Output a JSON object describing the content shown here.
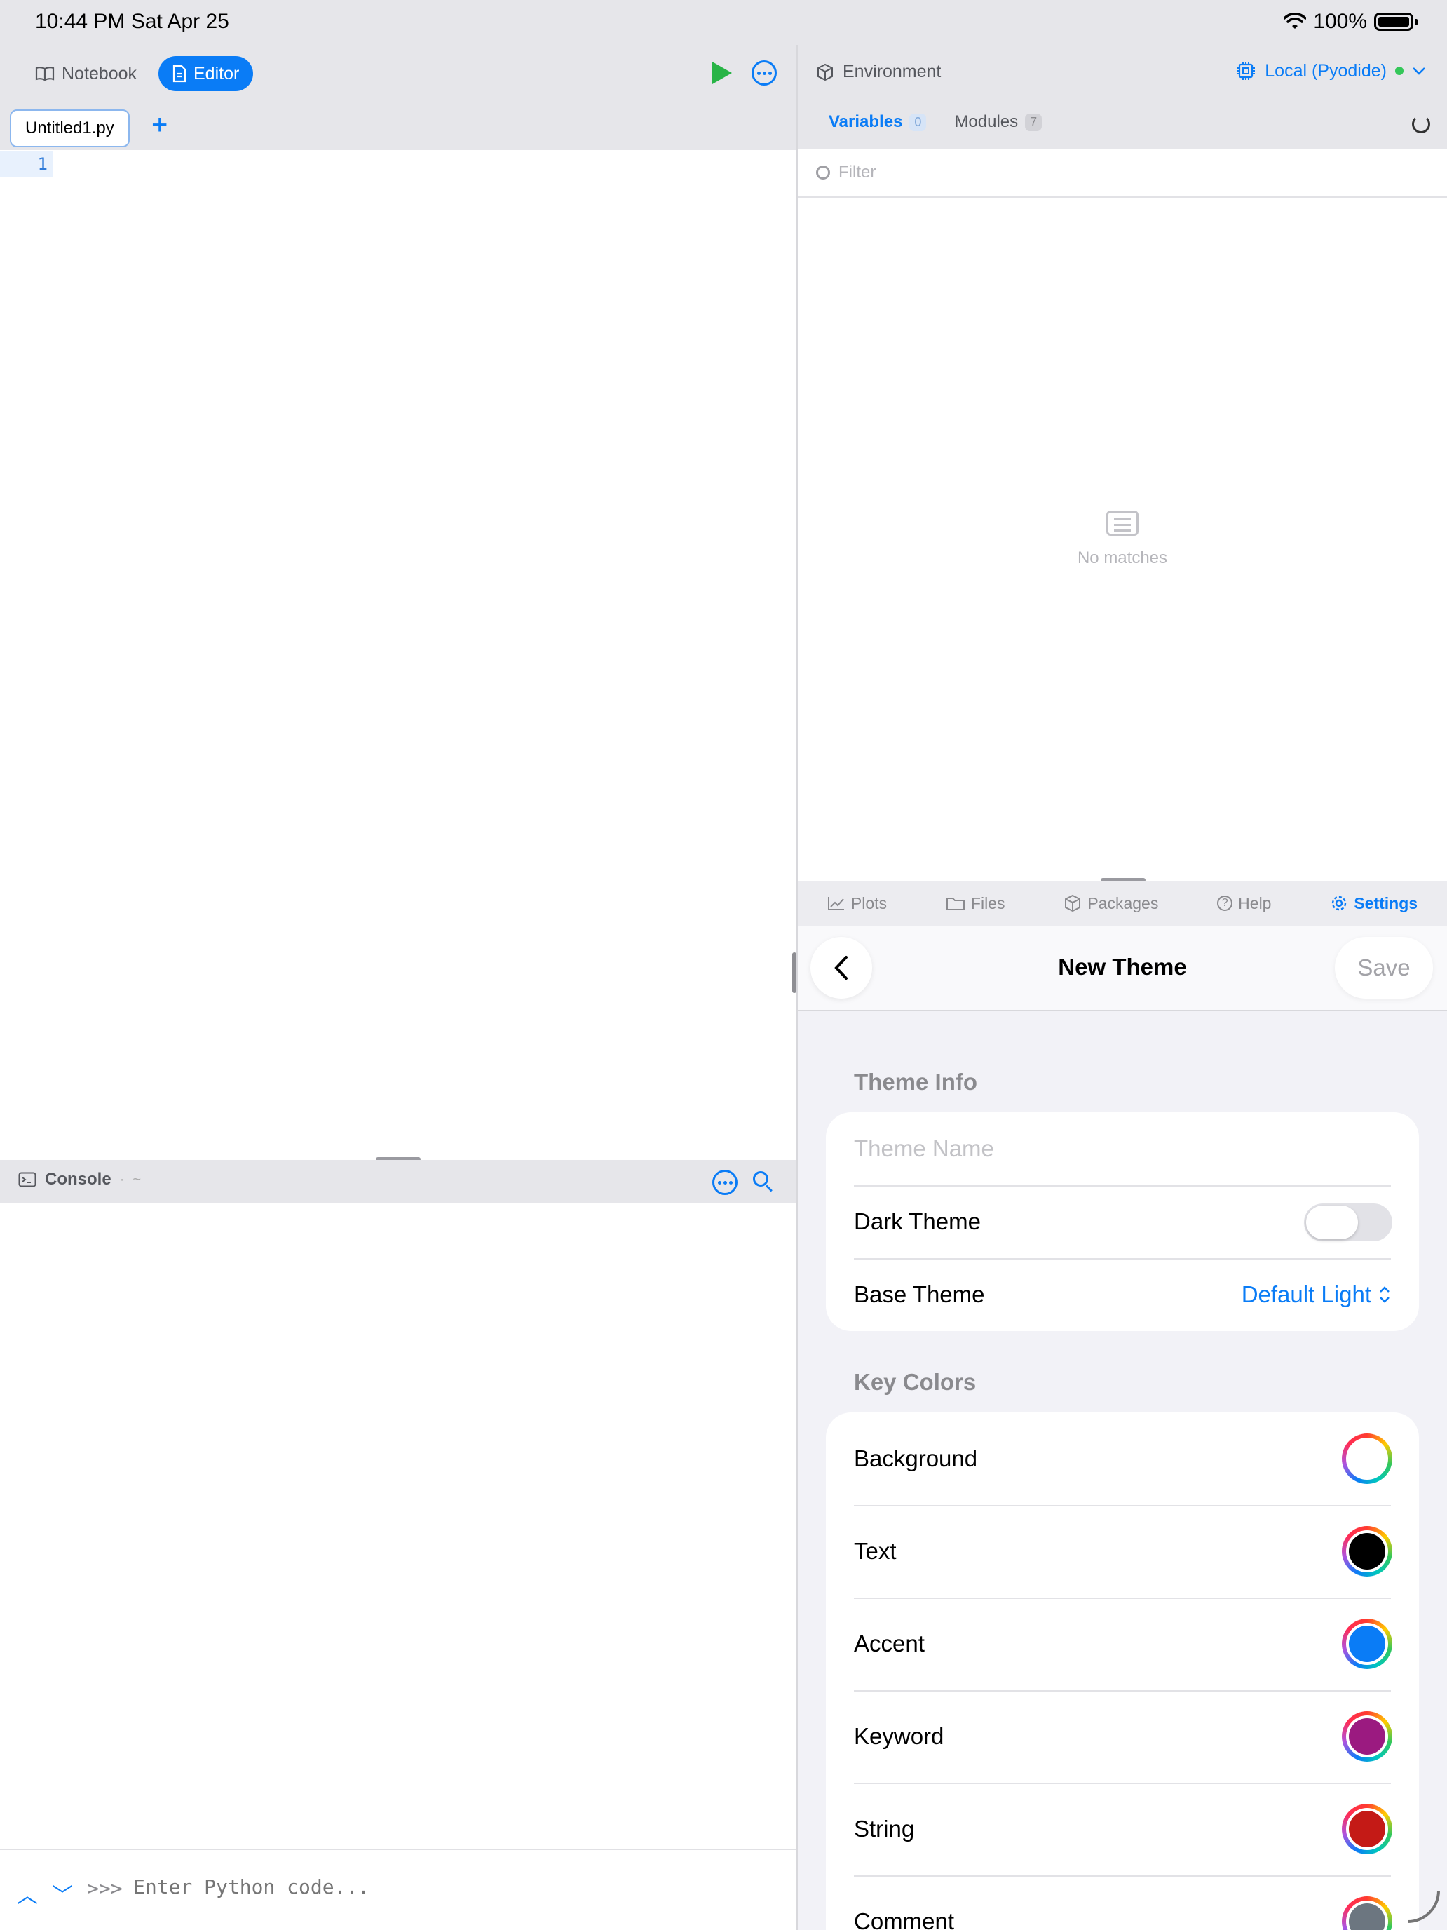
{
  "status_bar": {
    "time_date": "10:44 PM   Sat Apr 25",
    "battery": "100%"
  },
  "left": {
    "modes": {
      "notebook": "Notebook",
      "editor": "Editor"
    },
    "file_tab": "Untitled1.py",
    "line_number": "1",
    "console": {
      "title": "Console",
      "separator": "·",
      "path": "~",
      "prompt": ">>>",
      "input_placeholder": "Enter Python code..."
    }
  },
  "right": {
    "env_title": "Environment",
    "runtime": "Local (Pyodide)",
    "tabs": [
      {
        "label": "Variables",
        "count": "0"
      },
      {
        "label": "Modules",
        "count": "7"
      }
    ],
    "filter_placeholder": "Filter",
    "empty_text": "No matches",
    "tools": [
      "Plots",
      "Files",
      "Packages",
      "Help",
      "Settings"
    ],
    "settings": {
      "nav_title": "New Theme",
      "save_label": "Save",
      "theme_info_header": "Theme Info",
      "theme_name_placeholder": "Theme Name",
      "dark_theme_label": "Dark Theme",
      "dark_theme_on": false,
      "base_theme_label": "Base Theme",
      "base_theme_value": "Default Light",
      "key_colors_header": "Key Colors",
      "key_colors": [
        {
          "label": "Background",
          "color": "#ffffff"
        },
        {
          "label": "Text",
          "color": "#000000"
        },
        {
          "label": "Accent",
          "color": "#0a7cf6"
        },
        {
          "label": "Keyword",
          "color": "#9b1a80"
        },
        {
          "label": "String",
          "color": "#c41a16"
        },
        {
          "label": "Comment",
          "color": "#6c7680"
        }
      ]
    }
  },
  "colors": {
    "accent": "#0a7cf6",
    "run_green": "#28b446",
    "status_dot": "#34c759"
  }
}
